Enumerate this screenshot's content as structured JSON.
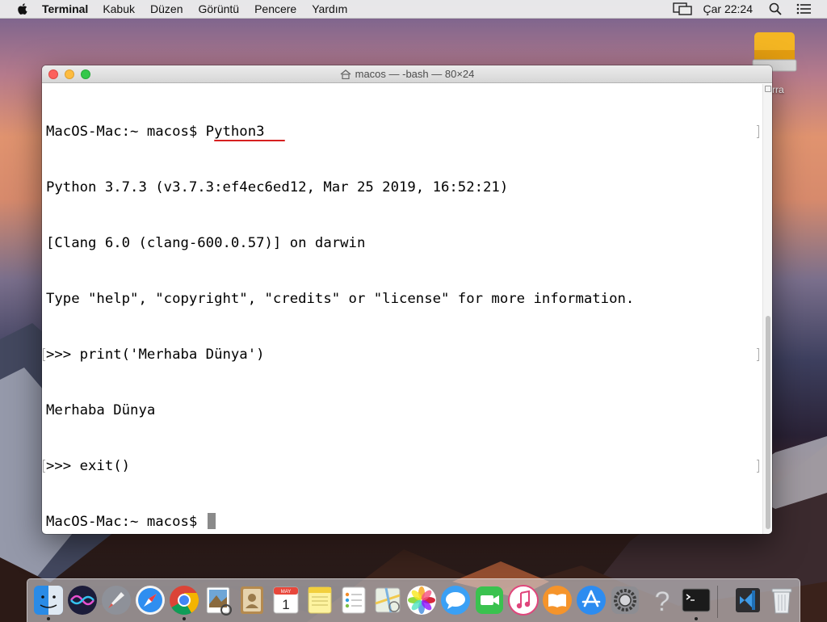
{
  "menubar": {
    "app_name": "Terminal",
    "menus": [
      "Kabuk",
      "Düzen",
      "Görüntü",
      "Pencere",
      "Yardım"
    ],
    "clock": "Çar 22:24"
  },
  "desktop": {
    "drive_label": "rra"
  },
  "window": {
    "title": "macos — -bash — 80×24",
    "lines": [
      "MacOS-Mac:~ macos$ Python3",
      "Python 3.7.3 (v3.7.3:ef4ec6ed12, Mar 25 2019, 16:52:21)",
      "[Clang 6.0 (clang-600.0.57)] on darwin",
      "Type \"help\", \"copyright\", \"credits\" or \"license\" for more information.",
      ">>> print('Merhaba Dünya')",
      "Merhaba Dünya",
      ">>> exit()",
      "MacOS-Mac:~ macos$ "
    ]
  },
  "dock": {
    "items": [
      "finder-icon",
      "siri-icon",
      "launchpad-icon",
      "safari-icon",
      "chrome-icon",
      "preview-icon",
      "contacts-icon",
      "calendar-icon",
      "notes-icon",
      "reminders-icon",
      "maps-icon",
      "photos-icon",
      "messages-icon",
      "facetime-icon",
      "itunes-icon",
      "ibooks-icon",
      "app-store-icon",
      "system-preferences-icon",
      "help-icon",
      "terminal-icon",
      "vscode-icon",
      "trash-icon"
    ],
    "calendar_month": "MAY",
    "calendar_day": "1"
  },
  "colors": {
    "accent_underline": "#d62020",
    "cursor": "#8a8a8a"
  }
}
